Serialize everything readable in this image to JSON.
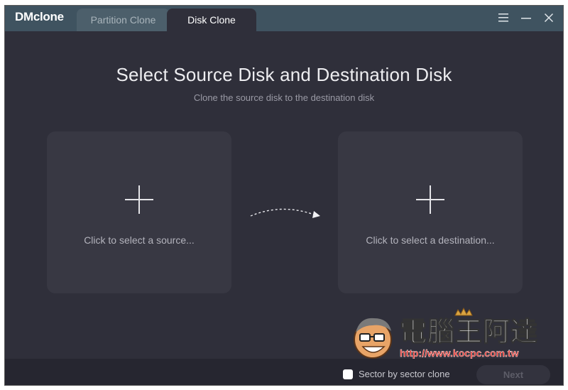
{
  "app": {
    "title": "DMclone"
  },
  "tabs": [
    {
      "label": "Partition Clone",
      "active": false
    },
    {
      "label": "Disk Clone",
      "active": true
    }
  ],
  "window_controls": [
    "menu-icon",
    "minimize-icon",
    "close-icon"
  ],
  "main": {
    "heading": "Select Source Disk and Destination Disk",
    "subheading": "Clone the source disk to the destination disk",
    "source": {
      "label": "Click to select a source...",
      "icon": "plus-icon"
    },
    "destination": {
      "label": "Click to select a destination...",
      "icon": "plus-icon"
    },
    "arrow_icon": "dashed-arrow-icon"
  },
  "watermark": {
    "text": "電腦王阿達",
    "url": "http://www.kocpc.com.tw"
  },
  "footer": {
    "sector_clone_label": "Sector by sector clone",
    "sector_clone_checked": false,
    "next_label": "Next",
    "next_enabled": false
  },
  "colors": {
    "titlebar": "#3f5360",
    "background": "#2f2f3a",
    "card": "#383843",
    "footer": "#262630",
    "watermark_red": "#e8322b"
  }
}
